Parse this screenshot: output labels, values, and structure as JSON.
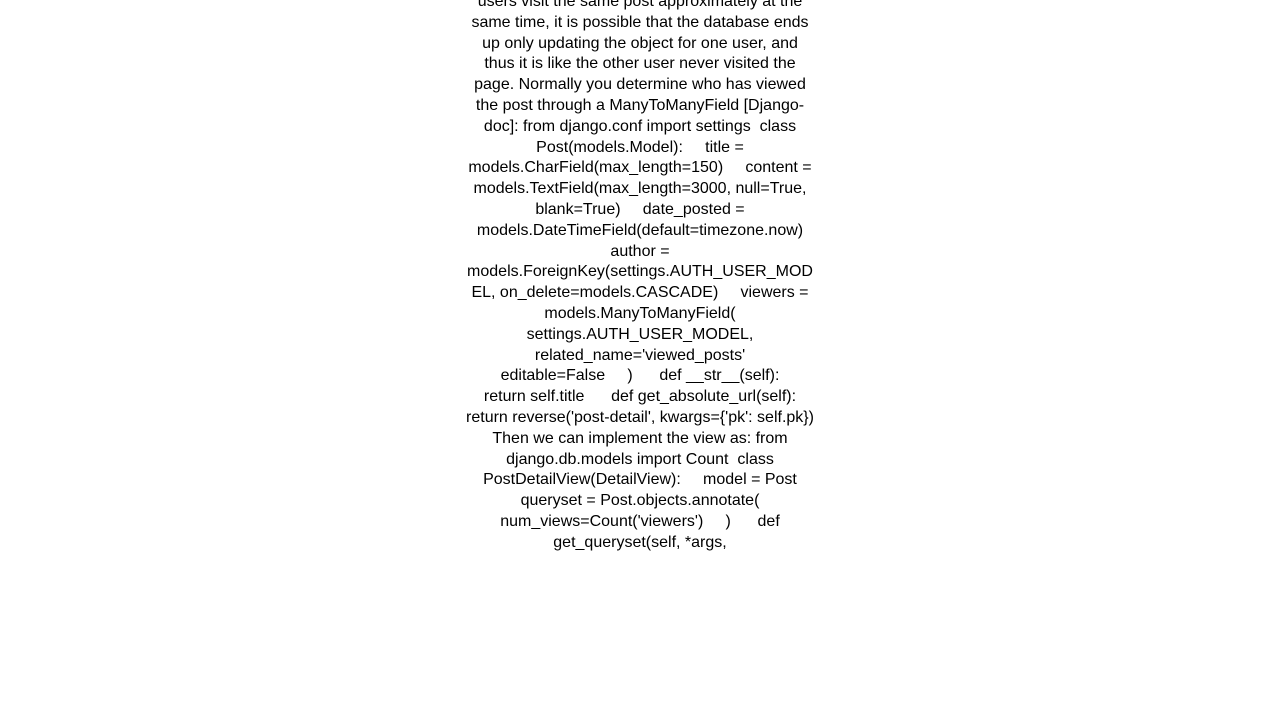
{
  "content": {
    "body": "users visit the same post approximately at the same time, it is possible that the database ends up only updating the object for one user, and thus it is like the other user never visited the page. Normally you determine who has viewed the post through a ManyToManyField [Django-doc]: from django.conf import settings  class Post(models.Model):     title = models.CharField(max_length=150)     content = models.TextField(max_length=3000, null=True, blank=True)     date_posted = models.DateTimeField(default=timezone.now)     author = models.ForeignKey(settings.AUTH_USER_MODEL, on_delete=models.CASCADE)     viewers = models.ManyToManyField(         settings.AUTH_USER_MODEL,         related_name='viewed_posts'         editable=False     )      def __str__(self):         return self.title      def get_absolute_url(self):         return reverse('post-detail', kwargs={'pk': self.pk}) Then we can implement the view as: from django.db.models import Count  class PostDetailView(DetailView):     model = Post     queryset = Post.objects.annotate(         num_views=Count('viewers')     )      def get_queryset(self, *args,"
  }
}
